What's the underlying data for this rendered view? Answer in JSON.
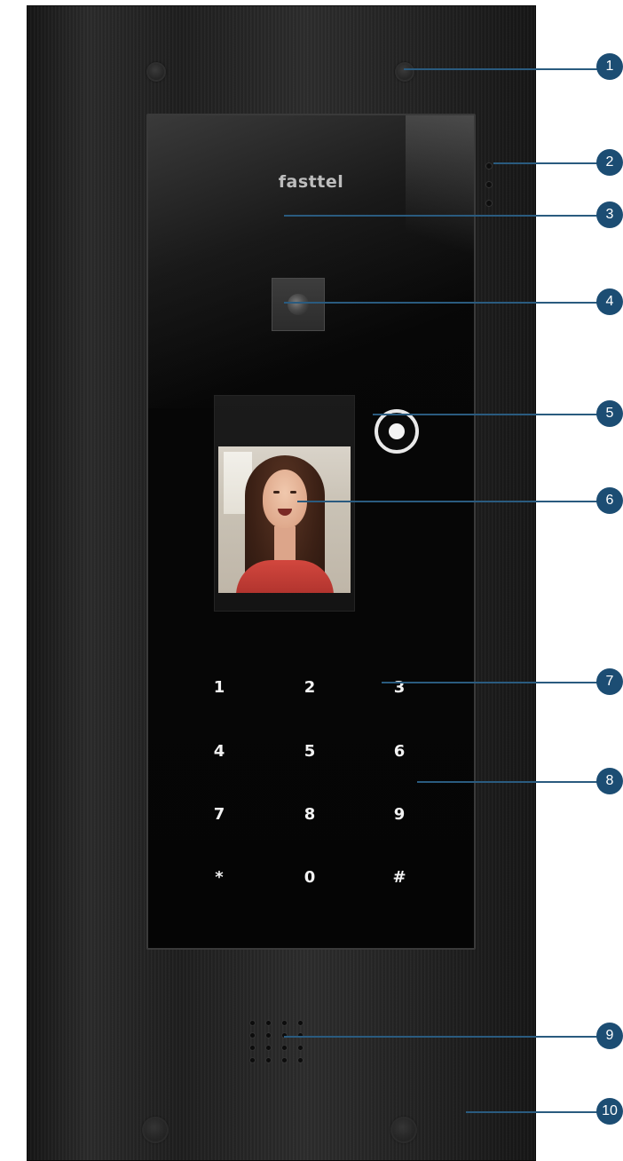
{
  "brand": "fasttel",
  "keypad": [
    "1",
    "2",
    "3",
    "4",
    "5",
    "6",
    "7",
    "8",
    "9",
    "*",
    "0",
    "#"
  ],
  "callouts": [
    "1",
    "2",
    "3",
    "4",
    "5",
    "6",
    "7",
    "8",
    "9",
    "10"
  ],
  "colors": {
    "panel": "#222222",
    "glass": "#060606",
    "callout": "#1c4d73",
    "key_text": "#f2f2f2"
  }
}
